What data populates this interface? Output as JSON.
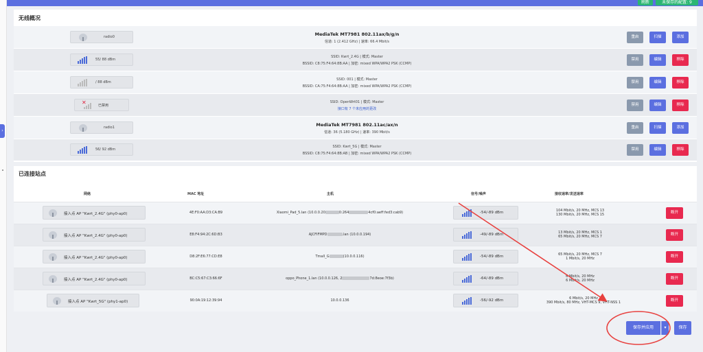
{
  "header": {
    "btn1": "刷新",
    "btn2": "未保存的配置: 9"
  },
  "wireless": {
    "title": "无线概况",
    "rows": [
      {
        "signal": "radio0",
        "title": "MediaTek MT7981 802.11ax/b/g/n",
        "sub": "信道: 1 (2.412 GHz) | 速率: 66.4 Mbit/s",
        "buttons": [
          "重启",
          "扫描",
          "添加"
        ]
      },
      {
        "signal": "55/ 88 dBm",
        "line1": "SSID: Kwrt_2.4G | 模式: Master",
        "line2": "BSSID: C8:75:F4:64:8B:AA | 加密: mixed WPA/WPA2 PSK (CCMP)",
        "buttons": [
          "禁用",
          "编辑",
          "移除"
        ]
      },
      {
        "signal": "/ 88 dBm",
        "line1": "SSID: 001 | 模式: Master",
        "line2": "BSSID: CA:75:F4:64:8B:AA | 加密: mixed WPA/WPA2 PSK (CCMP)",
        "buttons": [
          "禁用",
          "编辑",
          "移除"
        ]
      },
      {
        "signal": "已禁用",
        "line1": "SSID: OpenWrt01 | 模式: Master",
        "line2": "接口有 7 个未应用的更改",
        "buttons": [
          "禁用",
          "编辑",
          "移除"
        ]
      },
      {
        "signal": "radio1",
        "title": "MediaTek MT7981 802.11ac/ax/n",
        "sub": "信道: 36 (5.180 GHz) | 速率: 390 Mbit/s",
        "buttons": [
          "重启",
          "扫描",
          "添加"
        ]
      },
      {
        "signal": "56/ 92 dBm",
        "line1": "SSID: Kwrt_5G | 模式: Master",
        "line2": "BSSID: C8:75:F4:64:8B:AB | 加密: mixed WPA/WPA2 PSK (CCMP)",
        "buttons": [
          "禁用",
          "编辑",
          "移除"
        ]
      }
    ]
  },
  "stations": {
    "title": "已连接站点",
    "headers": [
      "网络",
      "MAC 地址",
      "主机",
      "信号/噪声",
      "接收速率/发送速率"
    ],
    "rows": [
      {
        "net": "接入点 AP \"Kwrt_2.4G\" (phy0-ap0)",
        "mac": "4E:F0:AA:D3:CA:B9",
        "host_a": "Xiaomi_Pad_5.lan (10.0.0.20",
        "host_b": "0:264",
        "host_c": "4cf0:aeff:fed3:cab9)",
        "signal": "-54/-89 dBm",
        "rate1": "104 Mbit/s, 20 MHz, MCS 13",
        "rate2": "130 Mbit/s, 20 MHz, MCS 15",
        "action": "断开"
      },
      {
        "net": "接入点 AP \"Kwrt_2.4G\" (phy0-ap0)",
        "mac": "E8:F4:94:2C:6D:B3",
        "host_a": "AJCFIFMPD",
        "host_b": ".lan (10.0.0.194)",
        "host_c": "",
        "signal": "-49/-89 dBm",
        "rate1": "13 Mbit/s, 20 MHz, MCS 1",
        "rate2": "65 Mbit/s, 20 MHz, MCS 7",
        "action": "断开"
      },
      {
        "net": "接入点 AP \"Kwrt_2.4G\" (phy0-ap0)",
        "mac": "D8:2F:E6:77:CD:E8",
        "host_a": "Tmall_G",
        "host_b": "(10.0.0.116)",
        "host_c": "",
        "signal": "-54/-89 dBm",
        "rate1": "65 Mbit/s, 20 MHz, MCS 7",
        "rate2": "1 Mbit/s, 20 MHz",
        "action": "断开"
      },
      {
        "net": "接入点 AP \"Kwrt_2.4G\" (phy0-ap0)",
        "mac": "BC:C5:67:C3:66:6F",
        "host_a": "oppo_Phone_1.lan (10.0.0.126, 2",
        "host_b": "7d:8eoe:7f3b)",
        "host_c": "",
        "signal": "-64/-89 dBm",
        "rate1": "6 Mbit/s, 20 MHz",
        "rate2": "6 Mbit/s, 20 MHz",
        "action": "断开"
      },
      {
        "net": "接入点 AP \"Kwrt_5G\" (phy1-ap0)",
        "mac": "90:0A:19:12:39:94",
        "host_a": "10.0.0.136",
        "host_b": "",
        "host_c": "",
        "signal": "-56/-92 dBm",
        "rate1": "6 Mbit/s, 20 MHz",
        "rate2": "390 Mbit/s, 80 MHz, VHT-MCS 9, VHT-NSS 1",
        "action": "断开"
      }
    ]
  },
  "footer": {
    "save_apply": "保存并应用",
    "caret": "▾",
    "save": "保存"
  },
  "colors": {
    "primary": "#5b6fe0",
    "danger": "#e8294f",
    "neutral": "#8a99ad",
    "annotation": "#e8413f"
  }
}
